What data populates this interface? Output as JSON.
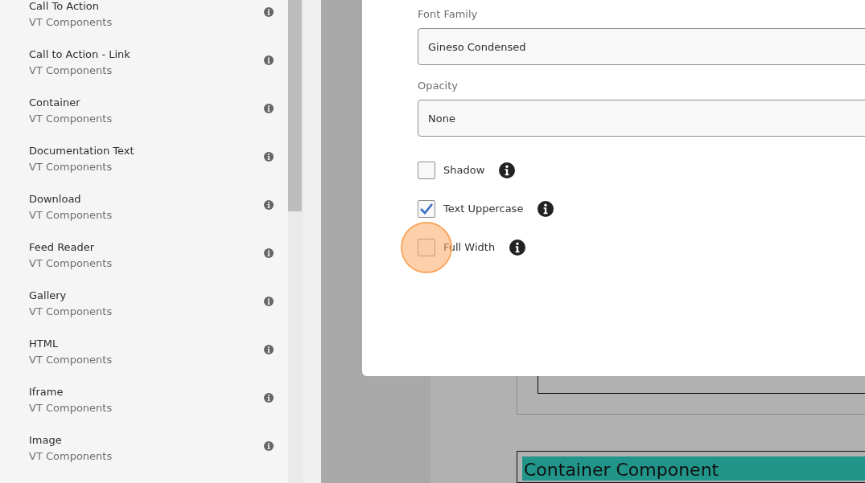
{
  "sidebar": {
    "items": [
      {
        "title": "Call To Action",
        "group": "VT Components"
      },
      {
        "title": "Call to Action - Link",
        "group": "VT Components"
      },
      {
        "title": "Container",
        "group": "VT Components"
      },
      {
        "title": "Documentation Text",
        "group": "VT Components"
      },
      {
        "title": "Download",
        "group": "VT Components"
      },
      {
        "title": "Feed Reader",
        "group": "VT Components"
      },
      {
        "title": "Gallery",
        "group": "VT Components"
      },
      {
        "title": "HTML",
        "group": "VT Components"
      },
      {
        "title": "Iframe",
        "group": "VT Components"
      },
      {
        "title": "Image",
        "group": "VT Components"
      }
    ]
  },
  "dialog": {
    "fields": [
      {
        "label": "Font Family",
        "value": "Gineso Condensed"
      },
      {
        "label": "Opacity",
        "value": "None"
      }
    ],
    "checkboxes": [
      {
        "label": "Shadow",
        "checked": false,
        "highlighted": false
      },
      {
        "label": "Text Uppercase",
        "checked": true,
        "highlighted": false
      },
      {
        "label": "Full Width",
        "checked": false,
        "highlighted": true
      }
    ]
  },
  "page": {
    "component_title": "Container Component"
  }
}
